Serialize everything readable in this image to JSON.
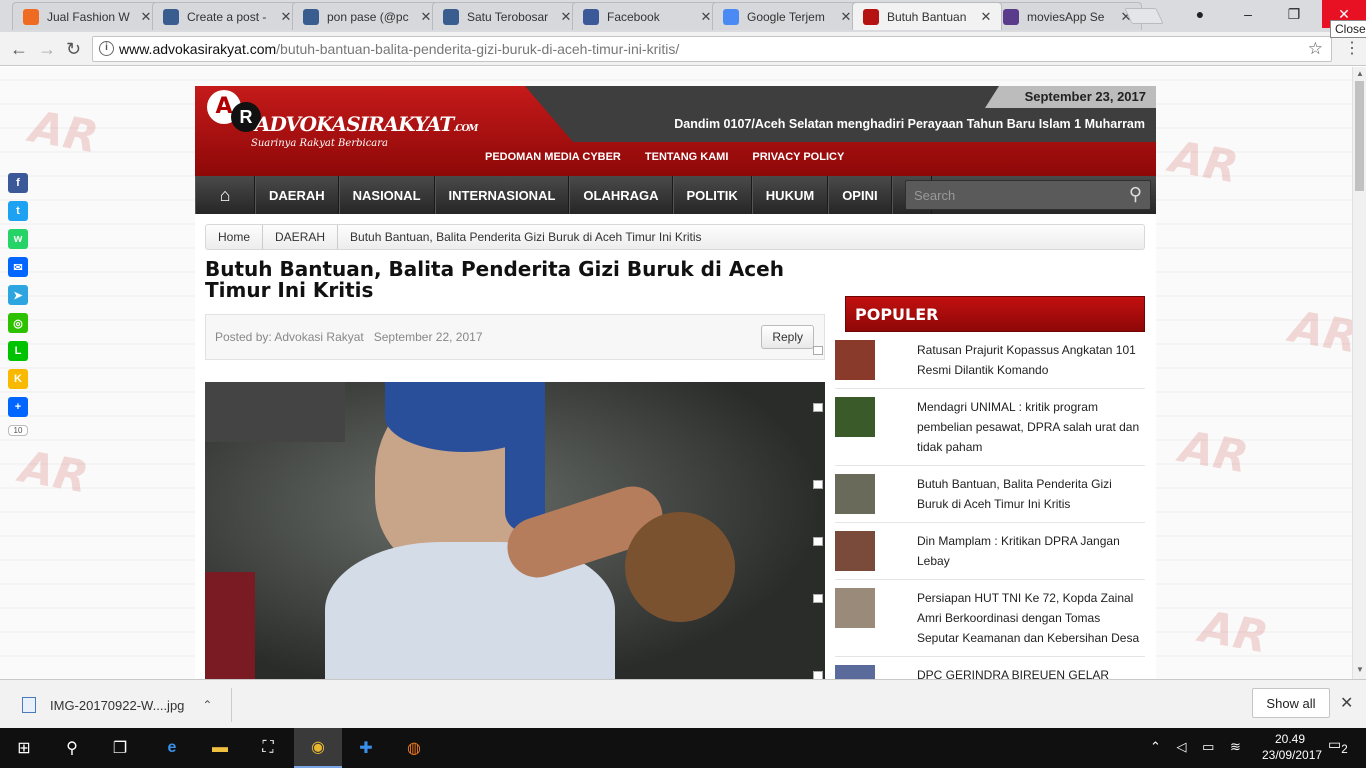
{
  "browser": {
    "tabs": [
      {
        "title": "Jual Fashion W",
        "icon": "orange-square-icon",
        "color": "#f06b22"
      },
      {
        "title": "Create a post -",
        "icon": "wordpress-icon",
        "color": "#3a5d8f"
      },
      {
        "title": "pon pase (@pc",
        "icon": "wordpress-icon",
        "color": "#3a5d8f"
      },
      {
        "title": "Satu Terobosar",
        "icon": "wordpress-icon",
        "color": "#3a5d8f"
      },
      {
        "title": "Facebook",
        "icon": "facebook-icon",
        "color": "#3b5998"
      },
      {
        "title": "Google Terjem",
        "icon": "google-translate-icon",
        "color": "#4a8af4"
      },
      {
        "title": "Butuh Bantuan",
        "icon": "advokasi-icon",
        "color": "#b51212"
      },
      {
        "title": "moviesApp Se",
        "icon": "floppy-icon",
        "color": "#5a3a8a"
      }
    ],
    "url_host": "www.advokasirakyat.com",
    "url_path": "/butuh-bantuan-balita-penderita-gizi-buruk-di-aceh-timur-ini-kritis/",
    "close_tooltip": "Close"
  },
  "site": {
    "date": "September 23, 2017",
    "ticker": "Dandim 0107/Aceh Selatan menghadiri Perayaan Tahun Baru Islam 1 Muharram",
    "logo_letter_a": "A",
    "logo_letter_r": "R",
    "logo_word": "ADVOKASIRAKYAT",
    "logo_tld": ".COM",
    "logo_tagline": "Suarinya Rakyat Berbicara",
    "top_links": [
      "PEDOMAN MEDIA CYBER",
      "TENTANG KAMI",
      "PRIVACY POLICY"
    ],
    "nav": [
      "DAERAH",
      "NASIONAL",
      "INTERNASIONAL",
      "OLAHRAGA",
      "POLITIK",
      "HUKUM",
      "OPINI"
    ],
    "search_placeholder": "Search"
  },
  "breadcrumb": [
    "Home",
    "DAERAH",
    "Butuh Bantuan, Balita Penderita Gizi Buruk di Aceh Timur Ini Kritis"
  ],
  "article": {
    "title": "Butuh Bantuan, Balita Penderita Gizi Buruk di Aceh Timur Ini Kritis",
    "posted_by": "Posted by: Advokasi Rakyat",
    "date": "September 22, 2017",
    "reply": "Reply"
  },
  "sidebar": {
    "heading": "POPULER",
    "items": [
      {
        "title": "Ratusan Prajurit Kopassus Angkatan 101 Resmi Dilantik Komando",
        "thumb_color": "#8a3a2a"
      },
      {
        "title": "Mendagri UNIMAL : kritik program pembelian pesawat, DPRA salah urat dan tidak paham",
        "thumb_color": "#3a5a2a"
      },
      {
        "title": "Butuh Bantuan, Balita Penderita Gizi Buruk di Aceh Timur Ini Kritis",
        "thumb_color": "#6a6a5a"
      },
      {
        "title": "Din Mamplam : Kritikan DPRA Jangan Lebay",
        "thumb_color": "#7a4a3a"
      },
      {
        "title": "Persiapan HUT TNI Ke 72, Kopda Zainal Amri Berkoordinasi dengan Tomas Seputar Keamanan dan Kebersihan Desa",
        "thumb_color": "#9a8a7a"
      },
      {
        "title": "DPC GERINDRA BIREUEN GELAR RAPAT KONSOLIDASI PENGURUS",
        "thumb_color": "#5a6a9a"
      }
    ]
  },
  "share": {
    "buttons": [
      {
        "name": "facebook",
        "glyph": "f",
        "color": "#3b5998"
      },
      {
        "name": "twitter",
        "glyph": "t",
        "color": "#1da1f2"
      },
      {
        "name": "whatsapp",
        "glyph": "w",
        "color": "#25d366"
      },
      {
        "name": "email",
        "glyph": "✉",
        "color": "#0166ff"
      },
      {
        "name": "telegram",
        "glyph": "➤",
        "color": "#2ca5e0"
      },
      {
        "name": "wechat",
        "glyph": "◎",
        "color": "#2dc100"
      },
      {
        "name": "line",
        "glyph": "L",
        "color": "#00c300"
      },
      {
        "name": "kakao",
        "glyph": "K",
        "color": "#f9b900"
      },
      {
        "name": "more",
        "glyph": "+",
        "color": "#0166ff"
      }
    ],
    "count": "10"
  },
  "download": {
    "filename": "IMG-20170922-W....jpg",
    "show_all": "Show all"
  },
  "taskbar": {
    "time": "20.49",
    "date": "23/09/2017",
    "notifications": "2"
  }
}
